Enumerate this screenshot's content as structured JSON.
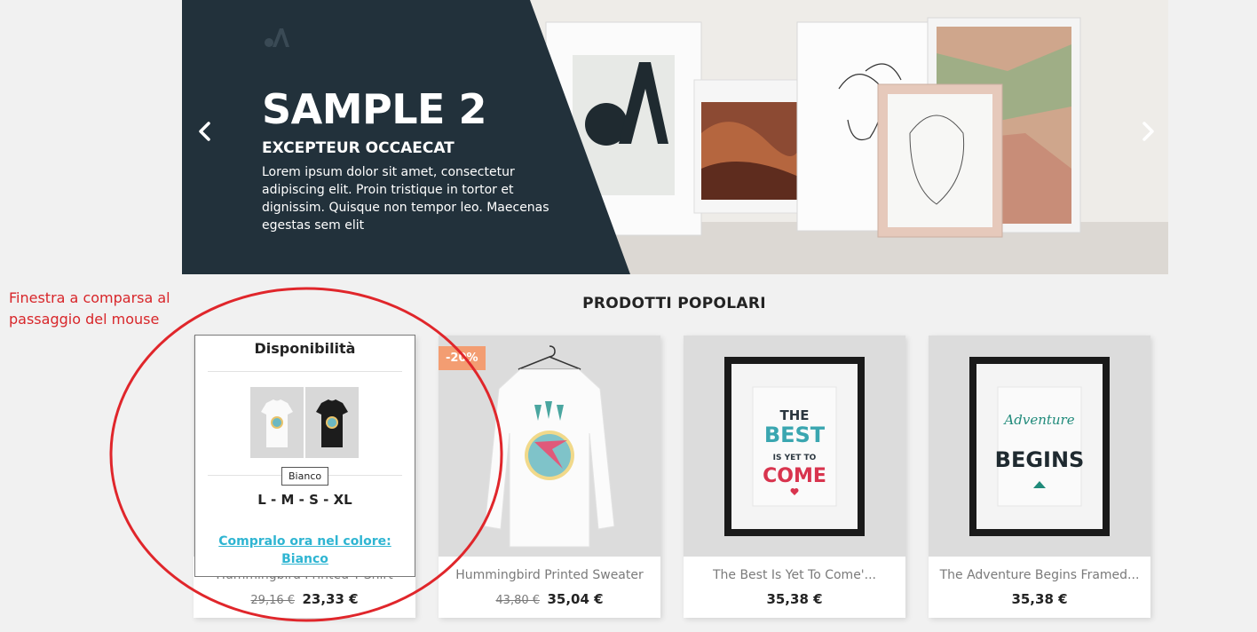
{
  "slider": {
    "title": "SAMPLE 2",
    "subtitle": "EXCEPTEUR OCCAECAT",
    "description": "Lorem ipsum dolor sit amet, consectetur adipiscing elit. Proin tristique in tortor et dignissim. Quisque non tempor leo. Maecenas egestas sem elit",
    "prev_icon": "chevron-left-icon",
    "next_icon": "chevron-right-icon",
    "panel_color": "#22313b"
  },
  "annotation": {
    "text": "Finestra a comparsa al passaggio del mouse",
    "color": "#d8262a"
  },
  "section": {
    "title": "PRODOTTI POPOLARI"
  },
  "popup": {
    "title": "Disponibilità",
    "colors": [
      "Bianco",
      "Nero"
    ],
    "tooltip": "Bianco",
    "sizes": "L - M - S - XL",
    "buy_link": "Compralo ora nel colore: Bianco"
  },
  "products": [
    {
      "name": "Hummingbird Printed T-Shirt",
      "old_price": "29,16 €",
      "price": "23,33 €"
    },
    {
      "name": "Hummingbird Printed Sweater",
      "old_price": "43,80 €",
      "price": "35,04 €",
      "badge": "-20%"
    },
    {
      "name": "The Best Is Yet To Come'...",
      "old_price": "",
      "price": "35,38 €"
    },
    {
      "name": "The Adventure Begins Framed...",
      "old_price": "",
      "price": "35,38 €"
    }
  ],
  "colors": {
    "accent_link": "#2fb5d2",
    "badge": "#f39d72",
    "text_dark": "#232323"
  }
}
